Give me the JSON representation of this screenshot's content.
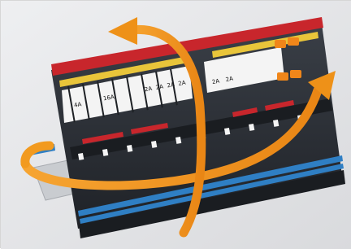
{
  "photo": {
    "subject": "terminal-block-assembly",
    "colors": {
      "background": "#e3e4e6",
      "housing": "#2b2f35",
      "red_bar": "#c8262c",
      "yellow_bar": "#e9c53a",
      "blue_bar": "#2f7fc4",
      "label": "#f7f7f7",
      "arrow": "#f0961e",
      "orange_clip": "#f0861a"
    },
    "labels_left": [
      "4A",
      "",
      "16A",
      "",
      "",
      "2A",
      "2A",
      "2A",
      "2A",
      "2A"
    ],
    "labels_right": [
      "2A",
      "2A"
    ],
    "icons": [
      "rotate-arrow-vertical-icon",
      "rotate-arrow-horizontal-icon"
    ]
  }
}
